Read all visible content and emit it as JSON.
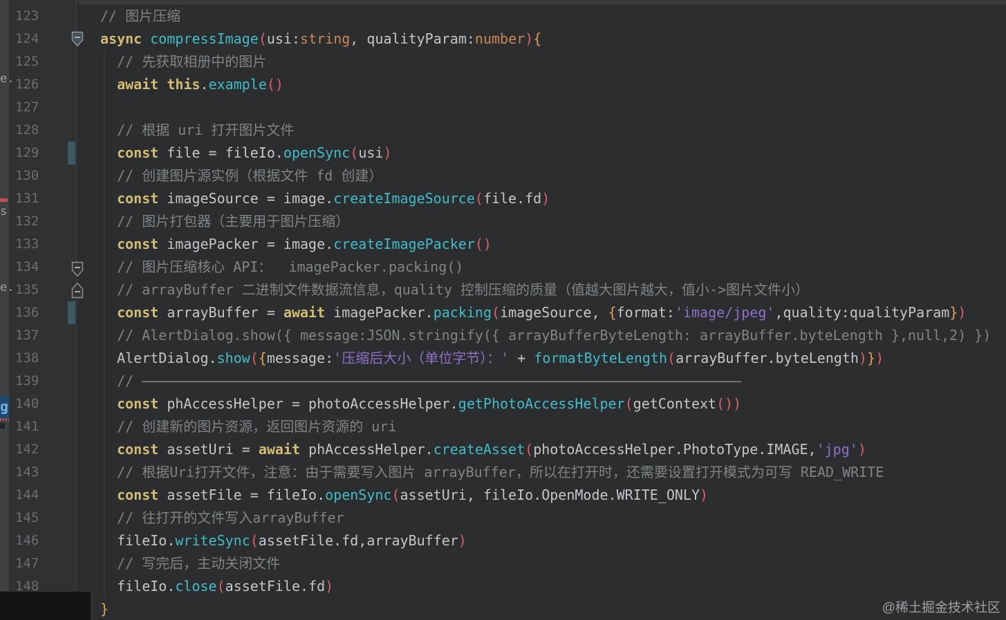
{
  "watermark": "@稀土掘金技术社区",
  "left_strip": {
    "frag1": "e.",
    "frag2": "s",
    "frag3": "e.",
    "frag4": "g"
  },
  "colors": {
    "kw": "#d3bd74",
    "fn": "#41bcc9",
    "pr": "#e0606a",
    "br": "#e5a14e",
    "st": "#8e6fc9",
    "ty": "#cc8755",
    "id": "#c3c7cb",
    "cm": "#7f8488",
    "dash": "#8d9296",
    "editor_bg": "#2b2d2e",
    "gutter_bg": "#2f3133",
    "change_marker": "#3b5a64",
    "error_mark": "#c75450"
  },
  "editor": {
    "lines": [
      {
        "n": "123",
        "t": [
          [
            "cm",
            "// 图片压缩"
          ]
        ]
      },
      {
        "n": "124",
        "t": [
          [
            "kw",
            "async"
          ],
          [
            "id",
            " "
          ],
          [
            "fn",
            "compressImage"
          ],
          [
            "pr",
            "("
          ],
          [
            "id",
            "usi:"
          ],
          [
            "ty",
            "string"
          ],
          [
            "id",
            ", qualityParam:"
          ],
          [
            "ty",
            "number"
          ],
          [
            "pr",
            ")"
          ],
          [
            "br",
            "{"
          ]
        ]
      },
      {
        "n": "125",
        "t": [
          [
            "cm",
            "  // 先获取相册中的图片"
          ]
        ]
      },
      {
        "n": "126",
        "t": [
          [
            "id",
            "  "
          ],
          [
            "kw",
            "await"
          ],
          [
            "id",
            " "
          ],
          [
            "kw",
            "this"
          ],
          [
            "id",
            "."
          ],
          [
            "fn",
            "example"
          ],
          [
            "pr",
            "()"
          ]
        ]
      },
      {
        "n": "127",
        "t": []
      },
      {
        "n": "128",
        "t": [
          [
            "cm",
            "  // 根据 uri 打开图片文件"
          ]
        ]
      },
      {
        "n": "129",
        "t": [
          [
            "id",
            "  "
          ],
          [
            "kw",
            "const"
          ],
          [
            "id",
            " file = fileIo."
          ],
          [
            "fn",
            "openSync"
          ],
          [
            "pr",
            "("
          ],
          [
            "id",
            "usi"
          ],
          [
            "pr",
            ")"
          ]
        ]
      },
      {
        "n": "130",
        "t": [
          [
            "cm",
            "  // 创建图片源实例（根据文件 fd 创建）"
          ]
        ]
      },
      {
        "n": "131",
        "t": [
          [
            "id",
            "  "
          ],
          [
            "kw",
            "const"
          ],
          [
            "id",
            " imageSource = image."
          ],
          [
            "fn",
            "createImageSource"
          ],
          [
            "pr",
            "("
          ],
          [
            "id",
            "file.fd"
          ],
          [
            "pr",
            ")"
          ]
        ]
      },
      {
        "n": "132",
        "t": [
          [
            "cm",
            "  // 图片打包器（主要用于图片压缩）"
          ]
        ]
      },
      {
        "n": "133",
        "t": [
          [
            "id",
            "  "
          ],
          [
            "kw",
            "const"
          ],
          [
            "id",
            " imagePacker = image."
          ],
          [
            "fn",
            "createImagePacker"
          ],
          [
            "pr",
            "()"
          ]
        ]
      },
      {
        "n": "134",
        "t": [
          [
            "cm",
            "  // 图片压缩核心 API：  imagePacker.packing()"
          ]
        ]
      },
      {
        "n": "135",
        "t": [
          [
            "cm",
            "  // arrayBuffer 二进制文件数据流信息，quality 控制压缩的质量（值越大图片越大，值小->图片文件小）"
          ]
        ]
      },
      {
        "n": "136",
        "t": [
          [
            "id",
            "  "
          ],
          [
            "kw",
            "const"
          ],
          [
            "id",
            " arrayBuffer = "
          ],
          [
            "kw",
            "await"
          ],
          [
            "id",
            " imagePacker."
          ],
          [
            "fn",
            "packing"
          ],
          [
            "pr",
            "("
          ],
          [
            "id",
            "imageSource, "
          ],
          [
            "br",
            "{"
          ],
          [
            "id",
            "format:"
          ],
          [
            "st",
            "'image/jpeg'"
          ],
          [
            "id",
            ",quality:qualityParam"
          ],
          [
            "br",
            "}"
          ],
          [
            "pr",
            ")"
          ]
        ]
      },
      {
        "n": "137",
        "t": [
          [
            "cm",
            "  // AlertDialog.show({ message:JSON.stringify({ arrayBufferByteLength: arrayBuffer.byteLength },null,2) })"
          ]
        ]
      },
      {
        "n": "138",
        "t": [
          [
            "id",
            "  AlertDialog."
          ],
          [
            "fn",
            "show"
          ],
          [
            "pr",
            "("
          ],
          [
            "br",
            "{"
          ],
          [
            "id",
            "message:"
          ],
          [
            "st",
            "'压缩后大小（单位字节）：' "
          ],
          [
            "id",
            "+ "
          ],
          [
            "fn",
            "formatByteLength"
          ],
          [
            "pr",
            "("
          ],
          [
            "id",
            "arrayBuffer.byteLength"
          ],
          [
            "pr",
            ")"
          ],
          [
            "br",
            "}"
          ],
          [
            "pr",
            ")"
          ]
        ]
      },
      {
        "n": "139",
        "t": [
          [
            "cm",
            "  // "
          ],
          [
            "dash",
            "————————————————————————————————————————————————————————————————————————"
          ]
        ]
      },
      {
        "n": "140",
        "t": [
          [
            "id",
            "  "
          ],
          [
            "kw",
            "const"
          ],
          [
            "id",
            " phAccessHelper = photoAccessHelper."
          ],
          [
            "fn",
            "getPhotoAccessHelper"
          ],
          [
            "pr",
            "("
          ],
          [
            "id",
            "getContext"
          ],
          [
            "pr",
            "())"
          ]
        ]
      },
      {
        "n": "141",
        "t": [
          [
            "cm",
            "  // 创建新的图片资源，返回图片资源的 uri"
          ]
        ]
      },
      {
        "n": "142",
        "t": [
          [
            "id",
            "  "
          ],
          [
            "kw",
            "const"
          ],
          [
            "id",
            " assetUri = "
          ],
          [
            "kw",
            "await"
          ],
          [
            "id",
            " phAccessHelper."
          ],
          [
            "fn",
            "createAsset"
          ],
          [
            "pr",
            "("
          ],
          [
            "id",
            "photoAccessHelper.PhotoType.IMAGE,"
          ],
          [
            "st",
            "'jpg'"
          ],
          [
            "pr",
            ")"
          ]
        ]
      },
      {
        "n": "143",
        "t": [
          [
            "cm",
            "  // 根据Uri打开文件，注意：由于需要写入图片 arrayBuffer，所以在打开时，还需要设置打开模式为可写 READ_WRITE"
          ]
        ]
      },
      {
        "n": "144",
        "t": [
          [
            "id",
            "  "
          ],
          [
            "kw",
            "const"
          ],
          [
            "id",
            " assetFile = fileIo."
          ],
          [
            "fn",
            "openSync"
          ],
          [
            "pr",
            "("
          ],
          [
            "id",
            "assetUri, fileIo.OpenMode.WRITE_ONLY"
          ],
          [
            "pr",
            ")"
          ]
        ]
      },
      {
        "n": "145",
        "t": [
          [
            "cm",
            "  // 往打开的文件写入arrayBuffer"
          ]
        ]
      },
      {
        "n": "146",
        "t": [
          [
            "id",
            "  fileIo."
          ],
          [
            "fn",
            "writeSync"
          ],
          [
            "pr",
            "("
          ],
          [
            "id",
            "assetFile.fd,arrayBuffer"
          ],
          [
            "pr",
            ")"
          ]
        ]
      },
      {
        "n": "147",
        "t": [
          [
            "cm",
            "  // 写完后，主动关闭文件"
          ]
        ]
      },
      {
        "n": "148",
        "t": [
          [
            "id",
            "  fileIo."
          ],
          [
            "fn",
            "close"
          ],
          [
            "pr",
            "("
          ],
          [
            "id",
            "assetFile.fd"
          ],
          [
            "pr",
            ")"
          ]
        ]
      },
      {
        "n": "",
        "t": [
          [
            "br",
            "}"
          ]
        ]
      }
    ]
  }
}
